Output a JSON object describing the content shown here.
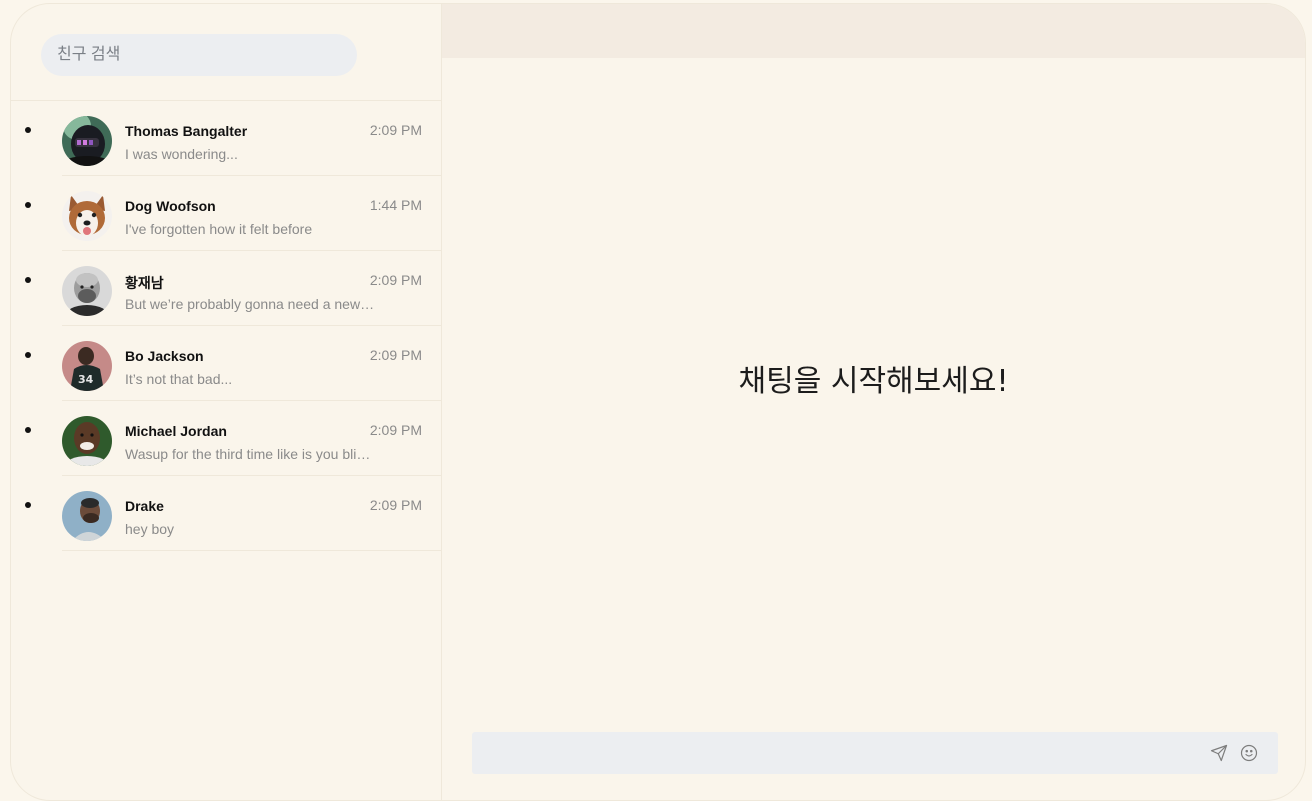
{
  "search": {
    "placeholder": "친구 검색"
  },
  "friends": [
    {
      "name": "Thomas Bangalter",
      "time": "2:09 PM",
      "preview": "I was wondering...",
      "avatar_icon": "helmet-avatar"
    },
    {
      "name": "Dog Woofson",
      "time": "1:44 PM",
      "preview": "I've forgotten how it felt before",
      "avatar_icon": "husky-avatar"
    },
    {
      "name": "황재남",
      "time": "2:09 PM",
      "preview": "But we’re probably gonna need a new carpet.",
      "avatar_icon": "man-avatar"
    },
    {
      "name": "Bo Jackson",
      "time": "2:09 PM",
      "preview": "It’s not that bad...",
      "avatar_icon": "football-player-avatar"
    },
    {
      "name": "Michael Jordan",
      "time": "2:09 PM",
      "preview": "Wasup for the third time like is you blind bitch",
      "avatar_icon": "man-avatar"
    },
    {
      "name": "Drake",
      "time": "2:09 PM",
      "preview": "hey boy",
      "avatar_icon": "man-avatar"
    }
  ],
  "chat": {
    "empty_message": "채팅을 시작해보세요!",
    "message_placeholder": "",
    "send_icon": "send-icon",
    "emoji_icon": "smiley-icon"
  },
  "colors": {
    "background": "#faf5eb",
    "header": "#f3ebe1",
    "input": "#eceef1",
    "muted_text": "#8a8a8a"
  }
}
